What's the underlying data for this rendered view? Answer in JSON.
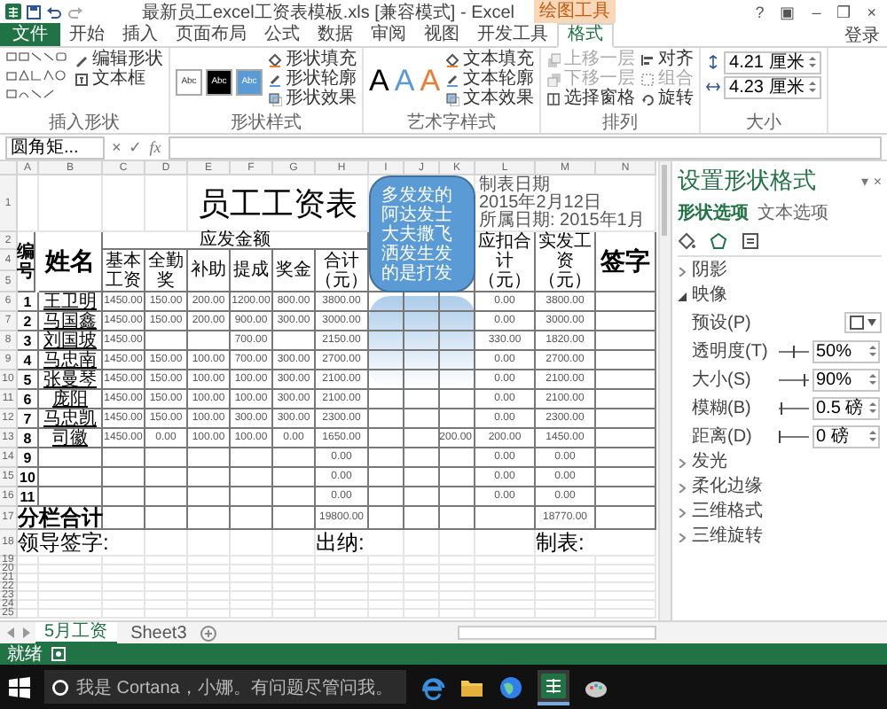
{
  "window": {
    "title": "最新员工excel工资表模板.xls [兼容模式] - Excel",
    "context_tab": "绘图工具",
    "controls": [
      "?",
      "▣",
      "–",
      "❐",
      "×"
    ]
  },
  "tabs": [
    {
      "label": "文件",
      "kind": "file",
      "selected": false
    },
    {
      "label": "开始",
      "kind": "tab",
      "selected": false
    },
    {
      "label": "插入",
      "kind": "tab",
      "selected": false
    },
    {
      "label": "页面布局",
      "kind": "tab",
      "selected": false
    },
    {
      "label": "公式",
      "kind": "tab",
      "selected": false
    },
    {
      "label": "数据",
      "kind": "tab",
      "selected": false
    },
    {
      "label": "审阅",
      "kind": "tab",
      "selected": false
    },
    {
      "label": "视图",
      "kind": "tab",
      "selected": false
    },
    {
      "label": "开发工具",
      "kind": "tab",
      "selected": false
    },
    {
      "label": "格式",
      "kind": "tab",
      "selected": true
    }
  ],
  "login": "登录",
  "ribbon": {
    "groups": [
      {
        "kind": "shapes",
        "label": "插入形状",
        "buttons": [
          {
            "label": "编辑形状",
            "disabled": false
          },
          {
            "label": "文本框",
            "disabled": false
          }
        ]
      },
      {
        "kind": "styles",
        "label": "形状样式",
        "swatches": [
          {
            "text": "Abc",
            "color": "#ffffff"
          },
          {
            "text": "Abc",
            "color": "#000000"
          },
          {
            "text": "Abc",
            "color": "#5b9bd5"
          }
        ],
        "buttons": [
          {
            "label": "形状填充",
            "disabled": false
          },
          {
            "label": "形状轮廓",
            "disabled": false
          },
          {
            "label": "形状效果",
            "disabled": false
          }
        ]
      },
      {
        "kind": "wordart",
        "label": "艺术字样式",
        "letters": [
          {
            "text": "A",
            "color": "#000000"
          },
          {
            "text": "A",
            "color": "#5b9bd5"
          },
          {
            "text": "A",
            "color": "#ed7d31"
          }
        ],
        "buttons": [
          {
            "label": "文本填充",
            "disabled": false
          },
          {
            "label": "文本轮廓",
            "disabled": false
          },
          {
            "label": "文本效果",
            "disabled": false
          }
        ]
      },
      {
        "kind": "arrange",
        "label": "排列",
        "buttons": [
          {
            "label": "上移一层",
            "disabled": true
          },
          {
            "label": "下移一层",
            "disabled": true
          },
          {
            "label": "选择窗格",
            "disabled": false
          },
          {
            "label": "对齐",
            "disabled": false
          },
          {
            "label": "组合",
            "disabled": true
          },
          {
            "label": "旋转",
            "disabled": false
          }
        ]
      },
      {
        "kind": "size",
        "label": "大小",
        "fields": [
          "4.21 厘米",
          "4.23 厘米"
        ]
      }
    ]
  },
  "formula_bar": {
    "name_box": "圆角矩...",
    "buttons": [
      "×",
      "✓",
      "fx"
    ]
  },
  "sheet": {
    "columns": [
      "A",
      "B",
      "C",
      "D",
      "E",
      "F",
      "G",
      "H",
      "I",
      "J",
      "K",
      "L",
      "M",
      "N"
    ],
    "row_numbers": [
      "1",
      "2",
      "4",
      "5",
      "6",
      "7",
      "8",
      "9",
      "10",
      "11",
      "12",
      "13",
      "14",
      "15",
      "16",
      "17",
      "18",
      "19",
      "20",
      "21",
      "22",
      "23",
      "24",
      "25"
    ],
    "title": "员工工资表",
    "date_line": "制表日期 2015年2月12日",
    "period_line": "所属日期: 2015年1月",
    "header": {
      "number": "编号",
      "name": "姓名",
      "group": "应发金额",
      "sub": [
        "基本工资",
        "全勤奖",
        "补助",
        "提成",
        "奖金",
        "合计（元）"
      ],
      "deduct": "应扣合计（元）",
      "net": "实发工资（元）",
      "sign": "签字"
    },
    "rows": [
      {
        "no": "1",
        "name": "王卫明",
        "pay": {
          "base": "1450.00",
          "attendance": "150.00",
          "allowance": "200.00",
          "commission": "1200.00",
          "bonus": "800.00"
        },
        "total": "3800.00",
        "deduct": "0.00",
        "net": "3800.00"
      },
      {
        "no": "2",
        "name": "马国鑫",
        "pay": {
          "base": "1450.00",
          "attendance": "150.00",
          "allowance": "200.00",
          "commission": "900.00",
          "bonus": "300.00"
        },
        "total": "3000.00",
        "deduct": "0.00",
        "net": "3000.00"
      },
      {
        "no": "3",
        "name": "刘国坡",
        "pay": {
          "base": "1450.00",
          "commission": "700.00"
        },
        "total": "2150.00",
        "deduct": "330.00",
        "net": "1820.00"
      },
      {
        "no": "4",
        "name": "马忠南",
        "pay": {
          "base": "1450.00",
          "attendance": "150.00",
          "allowance": "100.00",
          "commission": "700.00",
          "bonus": "300.00"
        },
        "total": "2700.00",
        "deduct": "0.00",
        "net": "2700.00"
      },
      {
        "no": "5",
        "name": "张曼琴",
        "pay": {
          "base": "1450.00",
          "attendance": "150.00",
          "allowance": "100.00",
          "commission": "100.00",
          "bonus": "300.00"
        },
        "total": "2100.00",
        "deduct": "0.00",
        "net": "2100.00"
      },
      {
        "no": "6",
        "name": "庞阳",
        "pay": {
          "base": "1450.00",
          "attendance": "150.00",
          "allowance": "100.00",
          "commission": "100.00",
          "bonus": "300.00"
        },
        "total": "2100.00",
        "deduct": "0.00",
        "net": "2100.00"
      },
      {
        "no": "7",
        "name": "马忠凯",
        "pay": {
          "base": "1450.00",
          "attendance": "150.00",
          "allowance": "100.00",
          "commission": "300.00",
          "bonus": "300.00"
        },
        "total": "2300.00",
        "deduct": "0.00",
        "net": "2300.00"
      },
      {
        "no": "8",
        "name": "司徽",
        "pay": {
          "base": "1450.00",
          "attendance": "0.00",
          "allowance": "100.00",
          "commission": "100.00",
          "bonus": "0.00"
        },
        "total": "1650.00",
        "column_k": "200.00",
        "deduct": "200.00",
        "net": "1450.00"
      },
      {
        "no": "9",
        "total": "0.00",
        "deduct": "0.00",
        "net": "0.00"
      },
      {
        "no": "10",
        "total": "0.00",
        "deduct": "0.00",
        "net": "0.00"
      },
      {
        "no": "11",
        "total": "0.00",
        "deduct": "0.00",
        "net": "0.00"
      }
    ],
    "totals": {
      "label": "分栏合计",
      "total": "19800.00",
      "net": "18770.00"
    },
    "footer": [
      "领导签字:",
      "出纳:",
      "制表:"
    ],
    "shape": {
      "text": "多发发的阿达发士大夫撒飞洒发生发的是打发"
    }
  },
  "pane": {
    "title": "设置形状格式",
    "controls": [
      "▾",
      "×"
    ],
    "tabs": [
      {
        "label": "形状选项",
        "selected": true
      },
      {
        "label": "文本选项",
        "selected": false
      }
    ],
    "sections": [
      {
        "label": "阴影",
        "expanded": false
      },
      {
        "label": "映像",
        "expanded": true,
        "props": [
          {
            "kind": "preset",
            "label": "预设(P)"
          },
          {
            "kind": "slider",
            "label": "透明度(T)",
            "level": 0.5,
            "value": "50%"
          },
          {
            "kind": "slider",
            "label": "大小(S)",
            "level": 0.9,
            "value": "90%"
          },
          {
            "kind": "slider",
            "label": "模糊(B)",
            "level": 0.05,
            "value": "0.5 磅"
          },
          {
            "kind": "slider",
            "label": "距离(D)",
            "level": 0,
            "value": "0 磅"
          }
        ]
      },
      {
        "label": "发光",
        "expanded": false
      },
      {
        "label": "柔化边缘",
        "expanded": false
      },
      {
        "label": "三维格式",
        "expanded": false
      },
      {
        "label": "三维旋转",
        "expanded": false
      }
    ]
  },
  "sheet_tabs": [
    {
      "label": "5月工资",
      "selected": true
    },
    {
      "label": "Sheet3",
      "selected": false
    }
  ],
  "status_bar": {
    "text": "就绪"
  },
  "taskbar": {
    "search": "我是 Cortana，小娜。有问题尽管问我。"
  }
}
